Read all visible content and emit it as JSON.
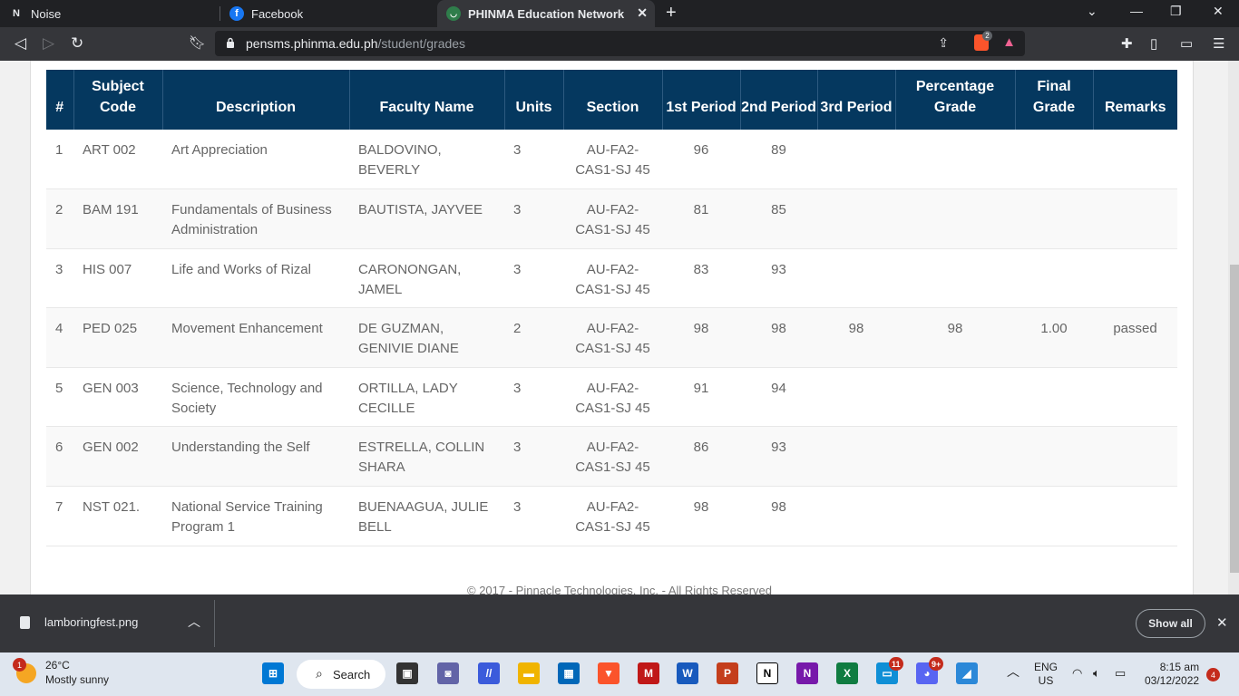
{
  "browser": {
    "tabs": [
      {
        "label": "Noise",
        "icon": "notion-icon"
      },
      {
        "label": "Facebook",
        "icon": "facebook-icon"
      },
      {
        "label": "PHINMA Education Network",
        "icon": "phinma-icon"
      }
    ],
    "url_host": "pensms.phinma.edu.ph",
    "url_path": "/student/grades",
    "shield_badge": "2"
  },
  "grades_table": {
    "headers": [
      "#",
      "Subject Code",
      "Description",
      "Faculty Name",
      "Units",
      "Section",
      "1st Period",
      "2nd Period",
      "3rd Period",
      "Percentage Grade",
      "Final Grade",
      "Remarks"
    ],
    "rows": [
      [
        "1",
        "ART 002",
        "Art Appreciation",
        "BALDOVINO, BEVERLY",
        "3",
        "AU-FA2-CAS1-SJ 45",
        "96",
        "89",
        "",
        "",
        "",
        ""
      ],
      [
        "2",
        "BAM 191",
        "Fundamentals of Business Administration",
        "BAUTISTA, JAYVEE",
        "3",
        "AU-FA2-CAS1-SJ 45",
        "81",
        "85",
        "",
        "",
        "",
        ""
      ],
      [
        "3",
        "HIS 007",
        "Life and Works of Rizal",
        "CARONONGAN, JAMEL",
        "3",
        "AU-FA2-CAS1-SJ 45",
        "83",
        "93",
        "",
        "",
        "",
        ""
      ],
      [
        "4",
        "PED 025",
        "Movement Enhancement",
        "DE GUZMAN, GENIVIE DIANE",
        "2",
        "AU-FA2-CAS1-SJ 45",
        "98",
        "98",
        "98",
        "98",
        "1.00",
        "passed"
      ],
      [
        "5",
        "GEN 003",
        "Science, Technology and Society",
        "ORTILLA, LADY CECILLE",
        "3",
        "AU-FA2-CAS1-SJ 45",
        "91",
        "94",
        "",
        "",
        "",
        ""
      ],
      [
        "6",
        "GEN 002",
        "Understanding the Self",
        "ESTRELLA, COLLIN SHARA",
        "3",
        "AU-FA2-CAS1-SJ 45",
        "86",
        "93",
        "",
        "",
        "",
        ""
      ],
      [
        "7",
        "NST 021.",
        "National Service Training Program 1",
        "BUENAAGUA, JULIE BELL",
        "3",
        "AU-FA2-CAS1-SJ 45",
        "98",
        "98",
        "",
        "",
        "",
        ""
      ]
    ]
  },
  "footer": {
    "text": "© 2017 - Pinnacle Technologies, Inc. - All Rights Reserved"
  },
  "download_bar": {
    "file": "lamboringfest.png",
    "show_all": "Show all"
  },
  "taskbar": {
    "weather_temp": "26°C",
    "weather_desc": "Mostly sunny",
    "weather_badge": "1",
    "search_label": "Search",
    "teams_badge": "11",
    "discord_badge": "9+",
    "lang": "ENG",
    "region": "US",
    "time": "8:15 am",
    "date": "03/12/2022",
    "notif_count": "4"
  },
  "colors": {
    "header_bg": "#05385f",
    "tab_bg": "#35363a"
  }
}
